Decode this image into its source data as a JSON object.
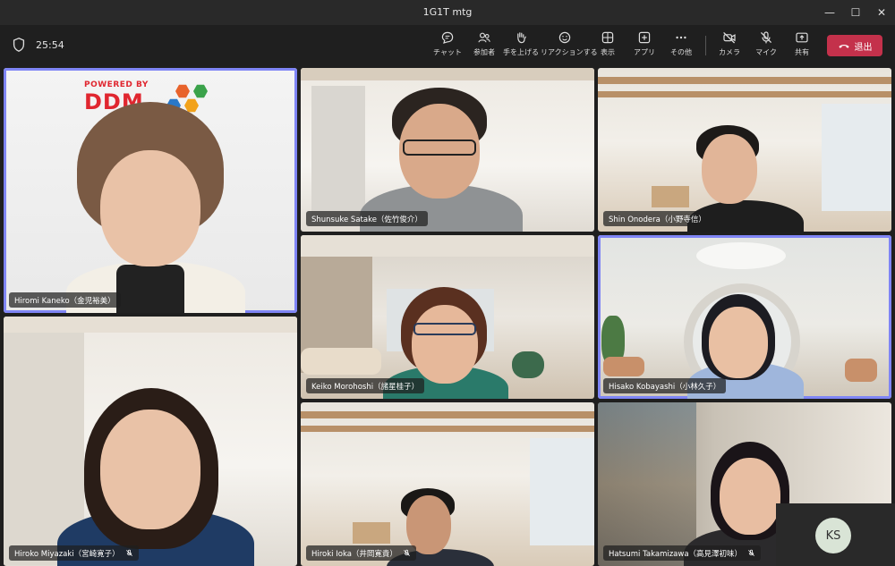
{
  "window": {
    "title": "1G1T mtg"
  },
  "toolbar": {
    "timer": "25:54",
    "buttons": [
      {
        "id": "chat",
        "label": "チャット",
        "icon": "chat-icon"
      },
      {
        "id": "people",
        "label": "参加者",
        "icon": "people-icon"
      },
      {
        "id": "raise",
        "label": "手を上げる",
        "icon": "raise-hand-icon"
      },
      {
        "id": "react",
        "label": "リアクションする",
        "icon": "smiley-icon"
      },
      {
        "id": "view",
        "label": "表示",
        "icon": "grid-view-icon"
      },
      {
        "id": "apps",
        "label": "アプリ",
        "icon": "add-app-icon"
      },
      {
        "id": "more",
        "label": "その他",
        "icon": "more-icon"
      },
      {
        "id": "camera",
        "label": "カメラ",
        "icon": "camera-off-icon"
      },
      {
        "id": "mic",
        "label": "マイク",
        "icon": "mic-off-icon"
      },
      {
        "id": "share",
        "label": "共有",
        "icon": "share-icon"
      }
    ],
    "leave_label": "退出"
  },
  "participants": [
    {
      "name": "Hiromi Kaneko（金児裕美）",
      "muted": false,
      "active": true
    },
    {
      "name": "Shunsuke Satake（佐竹俊介）",
      "muted": false,
      "active": false
    },
    {
      "name": "Shin Onodera（小野寺信）",
      "muted": false,
      "active": false
    },
    {
      "name": "Keiko Morohoshi（諸星桂子）",
      "muted": false,
      "active": false
    },
    {
      "name": "Hisako Kobayashi（小林久子）",
      "muted": false,
      "active": true
    },
    {
      "name": "Hiroko Miyazaki（宮崎寛子）",
      "muted": true,
      "active": false
    },
    {
      "name": "Hiroki Ioka（井岡寛貴）",
      "muted": true,
      "active": false
    },
    {
      "name": "Hatsumi Takamizawa（高見澤初味）",
      "muted": true,
      "active": false
    }
  ],
  "logo": {
    "line1": "POWERED BY",
    "line2": "DDM"
  },
  "self_view": {
    "initials": "KS"
  },
  "colors": {
    "accent": "#7f85f5",
    "leave": "#c4314b",
    "background": "#1f1f1f"
  }
}
